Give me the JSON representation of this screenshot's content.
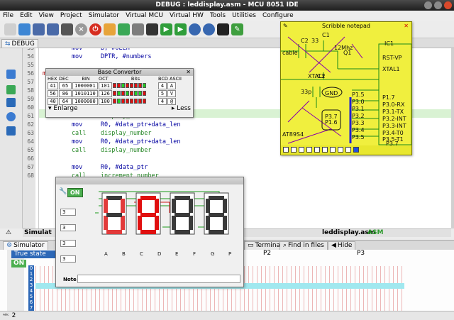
{
  "window": {
    "title": "DEBUG : leddisplay.asm - MCU 8051 IDE"
  },
  "menu": [
    "File",
    "Edit",
    "View",
    "Project",
    "Simulator",
    "Virtual MCU",
    "Virtual HW",
    "Tools",
    "Utilities",
    "Configure"
  ],
  "toolbar_icons": [
    "new-file",
    "open-file",
    "save",
    "save-all",
    "print",
    "close",
    "power",
    "report",
    "view",
    "find",
    "run",
    "step",
    "step-over",
    "hex-grid",
    "pencil"
  ],
  "file_tab": "DEBUG",
  "editor": {
    "lines": [
      {
        "n": "53",
        "code": "        mov     B, #0EEH"
      },
      {
        "n": "54",
        "code": "        mov     DPTR, #numbers"
      },
      {
        "n": "55",
        "code": ""
      },
      {
        "n": "56",
        "code": "mai"
      },
      {
        "n": "57",
        "code": ""
      },
      {
        "n": "58",
        "code": ""
      },
      {
        "n": "59",
        "code": ""
      },
      {
        "n": "60",
        "code": "        call    display_number"
      },
      {
        "n": "61",
        "code": "        call    display_number"
      },
      {
        "n": "62",
        "code": "        mov     R0, #data_ptr+data_len"
      },
      {
        "n": "63",
        "code": "        call    display_number"
      },
      {
        "n": "64",
        "code": "        mov     R0, #data_ptr+data_len"
      },
      {
        "n": "65",
        "code": "        call    display_number"
      },
      {
        "n": "66",
        "code": ""
      },
      {
        "n": "67",
        "code": "        mov     R0, #data_ptr"
      },
      {
        "n": "68",
        "code": "        call    increment_number"
      }
    ]
  },
  "status_row": {
    "left": "Simulat",
    "file": "leddisplay.asm",
    "mode": "ASM"
  },
  "base_convertor": {
    "title": "Base Convertor",
    "headers": [
      "HEX",
      "DEC",
      "BIN",
      "OCT",
      "Bits",
      "BCD",
      "ASCII"
    ],
    "rows": [
      {
        "hex": "41",
        "dec": "65",
        "bin": "1000001",
        "oct": "101",
        "bcd": "4",
        "ascii": "A",
        "bits": [
          "r",
          "r",
          "g",
          "r",
          "r",
          "r",
          "r",
          "g"
        ]
      },
      {
        "hex": "56",
        "dec": "86",
        "bin": "1010110",
        "oct": "126",
        "bcd": "5",
        "ascii": "V",
        "bits": [
          "r",
          "g",
          "r",
          "g",
          "r",
          "g",
          "g",
          "r"
        ]
      },
      {
        "hex": "40",
        "dec": "64",
        "bin": "1000000",
        "oct": "100",
        "bcd": "4",
        "ascii": "@",
        "bits": [
          "r",
          "g",
          "r",
          "r",
          "r",
          "r",
          "r",
          "r"
        ]
      }
    ],
    "enlarge": "Enlarge",
    "less": "Less"
  },
  "notepad": {
    "title": "Scribble notepad",
    "labels": [
      "C2",
      "33",
      "C1",
      "12Mhz",
      "Q1",
      "IC1",
      "RST-VP",
      "XTAL1",
      "XTAL2",
      "C3",
      "33p",
      "GND",
      "P1.5",
      "P3.0",
      "P3.1",
      "P3.2",
      "P3.3",
      "P3.4",
      "P3.5",
      "P3.7",
      "P1.6",
      "P1.7",
      "P3.0-RX",
      "P3.1-TX",
      "P3.2-INT",
      "P3.3-INT",
      "P3.4-T0",
      "P3.5-T1",
      "P3.7",
      "AT89S4",
      "cable",
      "R1"
    ]
  },
  "led_panel": {
    "on": "ON",
    "note_label": "Note",
    "digits": [
      "A",
      "B",
      "C",
      "D"
    ],
    "pins": [
      "A",
      "B",
      "C",
      "D",
      "E",
      "F",
      "G",
      "P"
    ],
    "row_values": [
      "3",
      "3",
      "3",
      "3"
    ]
  },
  "bottom_tabs": [
    "Simulator",
    "Terminal",
    "Find in files",
    "Hide"
  ],
  "graph": {
    "true_state": "True state",
    "on": "ON",
    "ports": [
      "P2",
      "P3"
    ],
    "rows": [
      "0",
      "1",
      "2",
      "3",
      "4",
      "5",
      "6",
      "7"
    ]
  },
  "statusbar": {
    "value": "2"
  },
  "colors": {
    "highlight": "#d9f2d3",
    "bit_red": "#e01010",
    "bit_green": "#22cc22",
    "title_bg": "#2b2b2b",
    "notepad": "#f0ef3e"
  }
}
